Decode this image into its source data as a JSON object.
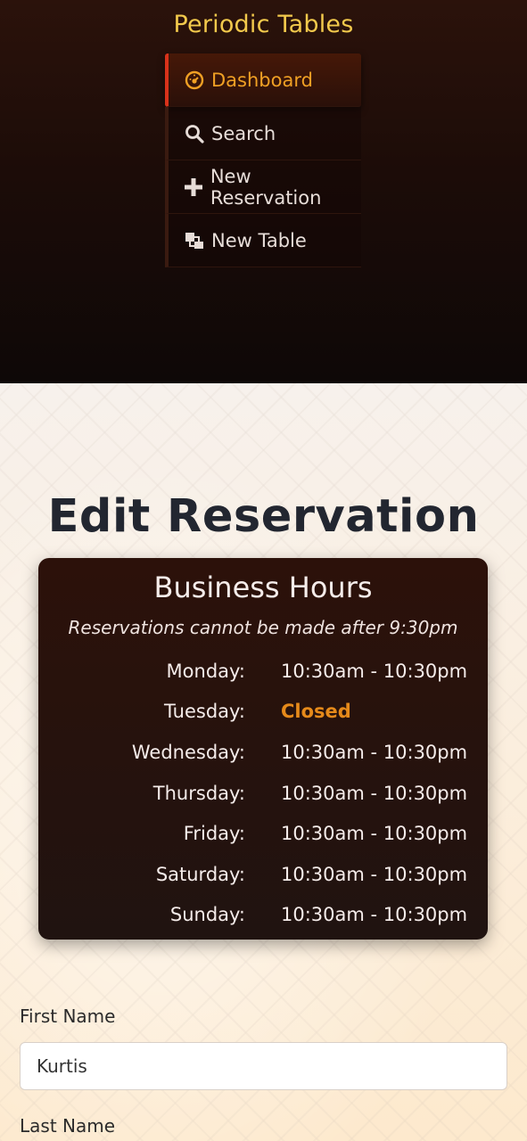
{
  "app": {
    "title": "Periodic Tables"
  },
  "nav": {
    "items": [
      {
        "label": "Dashboard",
        "icon": "dashboard-icon",
        "active": true
      },
      {
        "label": "Search",
        "icon": "search-icon",
        "active": false
      },
      {
        "label": "New Reservation",
        "icon": "plus-icon",
        "active": false
      },
      {
        "label": "New Table",
        "icon": "layers-icon",
        "active": false
      }
    ]
  },
  "page": {
    "title": "Edit Reservation"
  },
  "business_hours": {
    "title": "Business Hours",
    "note": "Reservations cannot be made after 9:30pm",
    "days": [
      {
        "day": "Monday:",
        "hours": "10:30am - 10:30pm"
      },
      {
        "day": "Tuesday:",
        "hours": "Closed"
      },
      {
        "day": "Wednesday:",
        "hours": "10:30am - 10:30pm"
      },
      {
        "day": "Thursday:",
        "hours": "10:30am - 10:30pm"
      },
      {
        "day": "Friday:",
        "hours": "10:30am - 10:30pm"
      },
      {
        "day": "Saturday:",
        "hours": "10:30am - 10:30pm"
      },
      {
        "day": "Sunday:",
        "hours": "10:30am - 10:30pm"
      }
    ]
  },
  "form": {
    "first_name": {
      "label": "First Name",
      "value": "Kurtis"
    },
    "last_name": {
      "label": "Last Name"
    }
  },
  "colors": {
    "brand": "#f2c94c",
    "active_nav": "#f0a024",
    "active_border": "#d8321a",
    "closed": "#e68a1a"
  }
}
